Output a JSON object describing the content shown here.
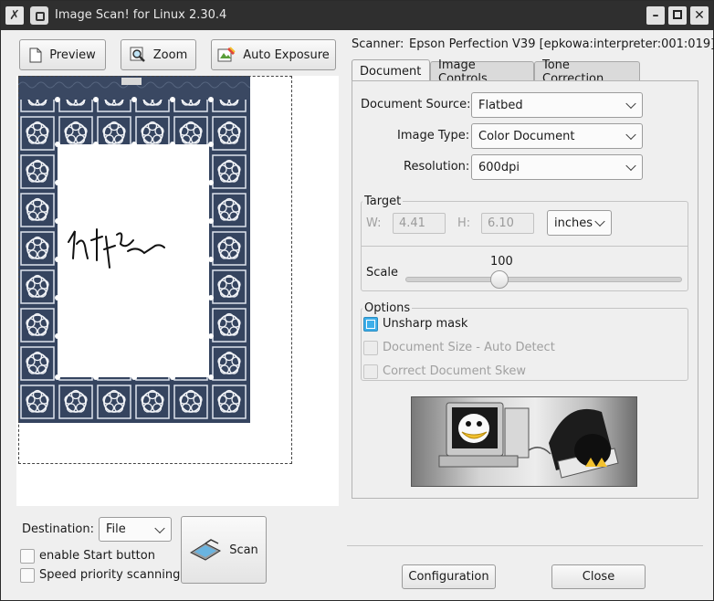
{
  "window": {
    "title": "Image Scan! for Linux 2.30.4"
  },
  "toolbar": {
    "preview_label": "Preview",
    "zoom_label": "Zoom",
    "auto_exposure_label": "Auto Exposure"
  },
  "scanner": {
    "label": "Scanner:",
    "value": "Epson Perfection V39 [epkowa:interpreter:001:019]"
  },
  "tabs": [
    {
      "label": "Document",
      "active": true
    },
    {
      "label": "Image Controls",
      "active": false
    },
    {
      "label": "Tone Correction",
      "active": false
    }
  ],
  "document": {
    "source_label": "Document Source:",
    "source_value": "Flatbed",
    "image_type_label": "Image Type:",
    "image_type_value": "Color Document",
    "resolution_label": "Resolution:",
    "resolution_value": "600dpi"
  },
  "target": {
    "title": "Target",
    "w_label": "W:",
    "w_value": "4.41",
    "h_label": "H:",
    "h_value": "6.10",
    "unit_value": "inches",
    "scale_label": "Scale",
    "scale_value": "100"
  },
  "options": {
    "title": "Options",
    "unsharp_mask": "Unsharp mask",
    "unsharp_mask_checked": true,
    "document_size": "Document Size - Auto Detect",
    "correct_skew": "Correct Document Skew"
  },
  "bottom_left": {
    "destination_label": "Destination:",
    "destination_value": "File",
    "enable_start": "enable Start button",
    "speed_priority": "Speed priority scanning",
    "scan_label": "Scan"
  },
  "footer": {
    "configuration_label": "Configuration",
    "close_label": "Close"
  },
  "colors": {
    "titlebar": "#2f2f2f",
    "accent": "#3daee9",
    "window_bg": "#efefef",
    "pattern_navy": "#35445f"
  }
}
